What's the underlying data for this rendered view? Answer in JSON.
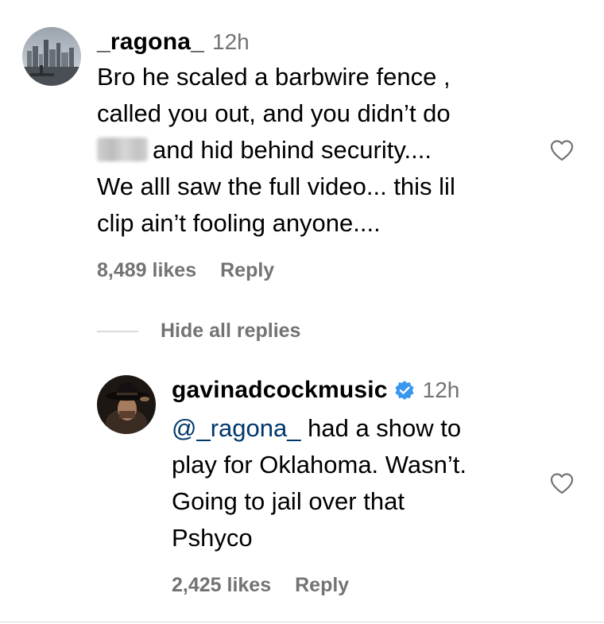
{
  "comments": [
    {
      "username": "_ragona_",
      "time": "12h",
      "lines": [
        "Bro he scaled a barbwire fence ,",
        "called you out, and you didn’t do",
        "and hid behind security....",
        "We alll saw the full video... this lil",
        "clip ain’t fooling anyone...."
      ],
      "likes": "8,489 likes",
      "reply": "Reply",
      "avatar_icon": "city-skyline-avatar",
      "heart_icon": "heart-outline-icon"
    }
  ],
  "replies_toggle": "Hide all replies",
  "replies": [
    {
      "username": "gavinadcockmusic",
      "verified": true,
      "time": "12h",
      "mention": "@_ragona_",
      "lines": [
        "had a show to",
        "play for Oklahoma. Wasn’t.",
        "Going to jail over that",
        "Pshyco"
      ],
      "likes": "2,425 likes",
      "reply": "Reply",
      "avatar_icon": "cowboy-hat-avatar",
      "heart_icon": "heart-outline-icon",
      "verified_color": "#3897f0"
    }
  ]
}
